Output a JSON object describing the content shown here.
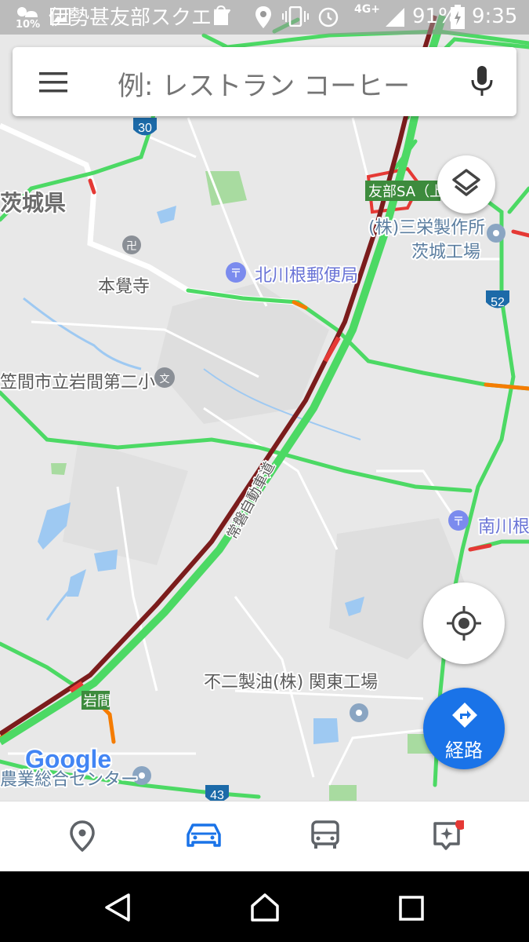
{
  "status_bar": {
    "notification_text": "伊勢甚友部スクエア",
    "weather_pct": "10%",
    "network": "4G+",
    "battery": "91%",
    "time": "9:35"
  },
  "search": {
    "placeholder": "例: レストラン コーヒー"
  },
  "map": {
    "prefecture": "茨城県",
    "temple": "本覺寺",
    "post_office_1": "北川根郵便局",
    "school": "笠間市立岩間第二小",
    "service_area": "友部SA（上り）",
    "factory_1_line1": "(株)三栄製作所",
    "factory_1_line2": "茨城工場",
    "post_office_2": "南川根",
    "factory_2": "不二製油(株) 関東工場",
    "station": "岩間",
    "center": "農業総合センター",
    "expressway": "常磐自動車道",
    "route_30": "30",
    "route_52": "52",
    "route_43": "43",
    "google": "Google"
  },
  "route_button": {
    "label": "経路"
  },
  "bottom_nav": {
    "items": [
      {
        "icon": "place-pin-icon"
      },
      {
        "icon": "car-icon"
      },
      {
        "icon": "bus-icon"
      },
      {
        "icon": "updates-sparkle-icon"
      }
    ]
  },
  "colors": {
    "accent": "#1a73e8",
    "traffic_slow": "#7b1c1c",
    "traffic_jam": "#e53935",
    "traffic_ok": "#4cd964",
    "traffic_mid": "#f57c00"
  }
}
